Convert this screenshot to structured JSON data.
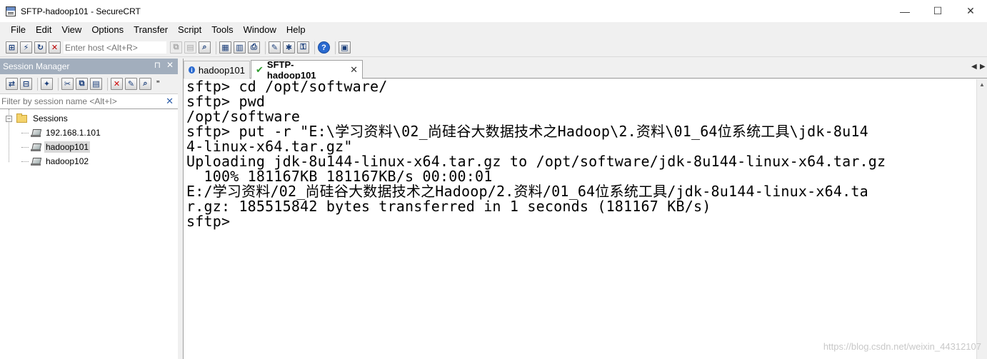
{
  "window": {
    "title": "SFTP-hadoop101 - SecureCRT",
    "minimize": "—",
    "maximize": "☐",
    "close": "✕"
  },
  "menu": [
    "File",
    "Edit",
    "View",
    "Options",
    "Transfer",
    "Script",
    "Tools",
    "Window",
    "Help"
  ],
  "toolbar": {
    "host_placeholder": "Enter host <Alt+R>"
  },
  "session_manager": {
    "title": "Session Manager",
    "pin": "⊓",
    "close": "✕",
    "more": "”",
    "filter_placeholder": "Filter by session name <Alt+I>",
    "filter_clear": "✕",
    "root_label": "Sessions",
    "root_expander": "−",
    "sessions": [
      "192.168.1.101",
      "hadoop101",
      "hadoop102"
    ],
    "selected": "hadoop101"
  },
  "tabs": [
    {
      "label": "hadoop101",
      "active": false
    },
    {
      "label": "SFTP-hadoop101",
      "active": true,
      "close": "✕"
    }
  ],
  "tab_scroll": {
    "left": "◀",
    "right": "▶"
  },
  "terminal": {
    "lines": [
      "sftp> cd /opt/software/",
      "sftp> pwd",
      "/opt/software",
      "sftp> put -r \"E:\\学习资料\\02_尚硅谷大数据技术之Hadoop\\2.资料\\01_64位系统工具\\jdk-8u14",
      "4-linux-x64.tar.gz\"",
      "Uploading jdk-8u144-linux-x64.tar.gz to /opt/software/jdk-8u144-linux-x64.tar.gz",
      "  100% 181167KB 181167KB/s 00:00:01",
      "E:/学习资料/02_尚硅谷大数据技术之Hadoop/2.资料/01_64位系统工具/jdk-8u144-linux-x64.ta",
      "r.gz: 185515842 bytes transferred in 1 seconds (181167 KB/s)",
      "sftp>"
    ]
  },
  "scrollbar": {
    "up": "▲",
    "down": "▼"
  },
  "watermark": "https://blog.csdn.net/weixin_44312107"
}
